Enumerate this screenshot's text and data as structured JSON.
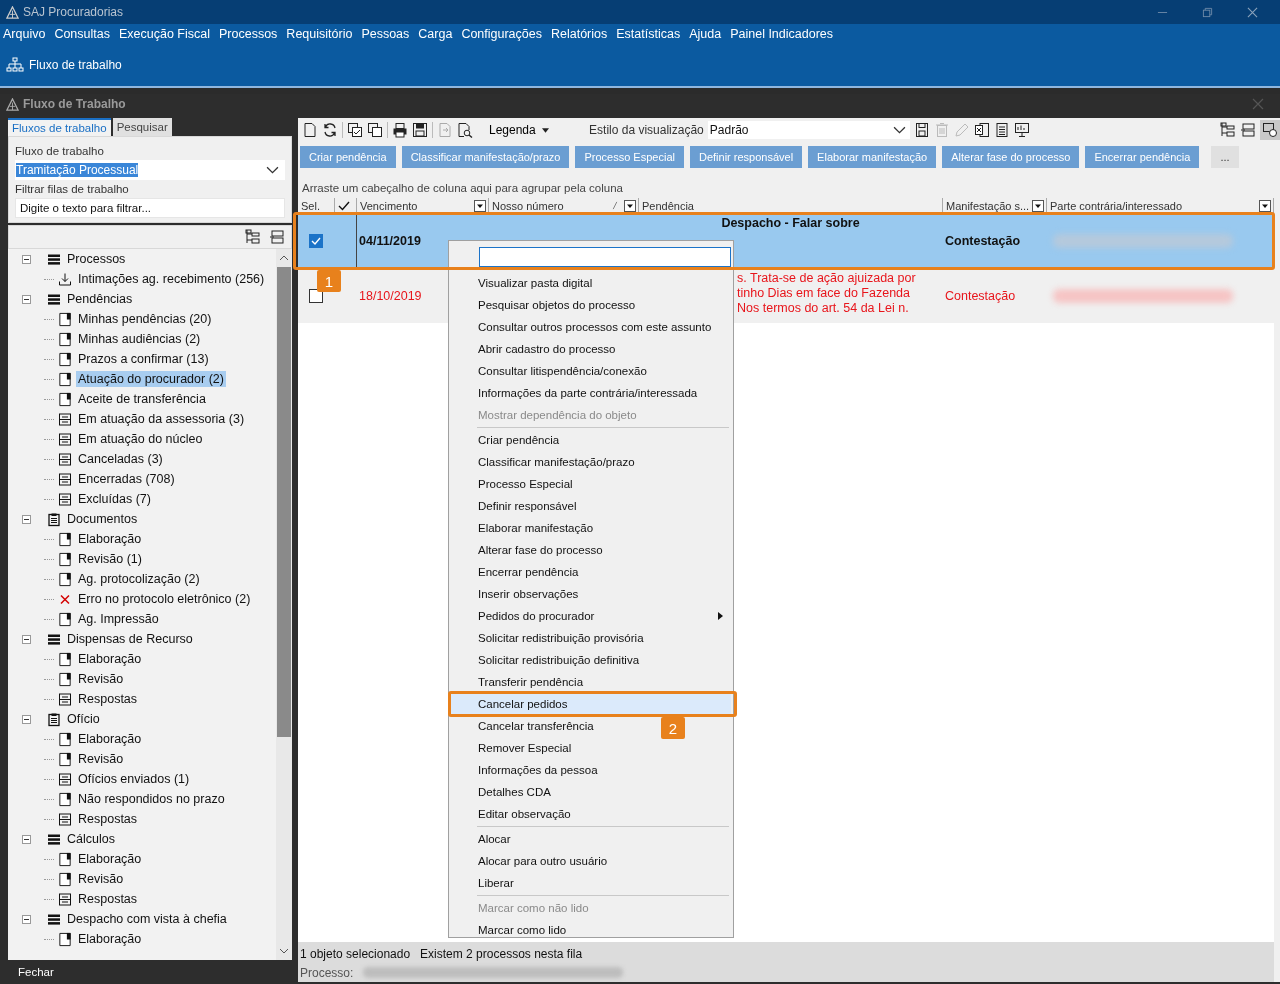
{
  "app_window": {
    "title": "SAJ Procuradorias"
  },
  "menu_bar": [
    "Arquivo",
    "Consultas",
    "Execução Fiscal",
    "Processos",
    "Requisitório",
    "Pessoas",
    "Carga",
    "Configurações",
    "Relatórios",
    "Estatísticas",
    "Ajuda",
    "Painel Indicadores"
  ],
  "ribbon": {
    "label": "Fluxo de trabalho"
  },
  "inner_window": {
    "title": "Fluxo de Trabalho"
  },
  "left_tabs": [
    {
      "label": "Fluxos de trabalho",
      "selected": true
    },
    {
      "label": "Pesquisar",
      "selected": false
    }
  ],
  "workflow": {
    "label": "Fluxo de trabalho",
    "value": "Tramitação Processual"
  },
  "filter": {
    "label": "Filtrar filas de trabalho",
    "placeholder": "Digite o texto para filtrar..."
  },
  "tree": [
    {
      "label": "Processos",
      "kind": "list",
      "expanded": true,
      "children": [
        {
          "label": "Intimações ag. recebimento (256)",
          "kind": "download",
          "selected": false
        }
      ]
    },
    {
      "label": "Pendências",
      "kind": "list",
      "expanded": true,
      "children": [
        {
          "label": "Minhas pendências (20)",
          "kind": "page",
          "selected": false
        },
        {
          "label": "Minhas audiências (2)",
          "kind": "page",
          "selected": false
        },
        {
          "label": "Prazos a confirmar (13)",
          "kind": "page",
          "selected": false
        },
        {
          "label": "Atuação do procurador (2)",
          "kind": "page",
          "selected": true
        },
        {
          "label": "Aceite de transferência",
          "kind": "page",
          "selected": false
        },
        {
          "label": "Em atuação da assessoria (3)",
          "kind": "table",
          "selected": false
        },
        {
          "label": "Em atuação do núcleo",
          "kind": "table",
          "selected": false
        },
        {
          "label": "Canceladas (3)",
          "kind": "table",
          "selected": false
        },
        {
          "label": "Encerradas (708)",
          "kind": "table",
          "selected": false
        },
        {
          "label": "Excluídas (7)",
          "kind": "table",
          "selected": false
        }
      ]
    },
    {
      "label": "Documentos",
      "kind": "clipboard",
      "expanded": true,
      "children": [
        {
          "label": "Elaboração",
          "kind": "page",
          "selected": false
        },
        {
          "label": "Revisão (1)",
          "kind": "page",
          "selected": false
        },
        {
          "label": "Ag. protocolização (2)",
          "kind": "page",
          "selected": false
        },
        {
          "label": "Erro no protocolo eletrônico (2)",
          "kind": "error",
          "selected": false
        },
        {
          "label": "Ag. Impressão",
          "kind": "page",
          "selected": false
        }
      ]
    },
    {
      "label": "Dispensas de Recurso",
      "kind": "list",
      "expanded": true,
      "children": [
        {
          "label": "Elaboração",
          "kind": "page",
          "selected": false
        },
        {
          "label": "Revisão",
          "kind": "page",
          "selected": false
        },
        {
          "label": "Respostas",
          "kind": "table",
          "selected": false
        }
      ]
    },
    {
      "label": "Ofício",
      "kind": "clipboard",
      "expanded": true,
      "children": [
        {
          "label": "Elaboração",
          "kind": "page",
          "selected": false
        },
        {
          "label": "Revisão",
          "kind": "page",
          "selected": false
        },
        {
          "label": "Ofícios enviados (1)",
          "kind": "table",
          "selected": false
        },
        {
          "label": "Não respondidos no prazo",
          "kind": "page",
          "selected": false
        },
        {
          "label": "Respostas",
          "kind": "table",
          "selected": false
        }
      ]
    },
    {
      "label": "Cálculos",
      "kind": "list",
      "expanded": true,
      "children": [
        {
          "label": "Elaboração",
          "kind": "page",
          "selected": false
        },
        {
          "label": "Revisão",
          "kind": "page",
          "selected": false
        },
        {
          "label": "Respostas",
          "kind": "table",
          "selected": false
        }
      ]
    },
    {
      "label": "Despacho com vista à chefia",
      "kind": "list",
      "expanded": true,
      "children": [
        {
          "label": "Elaboração",
          "kind": "page",
          "selected": false
        }
      ]
    }
  ],
  "close_button": "Fechar",
  "toolbar": {
    "legend": "Legenda",
    "style_label": "Estilo da visualização",
    "style_value": "Padrão"
  },
  "actions": [
    "Criar pendência",
    "Classificar manifestação/prazo",
    "Processo Especial",
    "Definir responsável",
    "Elaborar manifestação",
    "Alterar fase do processo",
    "Encerrar pendência",
    "..."
  ],
  "group_hint": "Arraste um cabeçalho de coluna aqui para agrupar pela coluna",
  "table": {
    "columns": [
      {
        "label": "Sel.",
        "kind": "text",
        "filter": false
      },
      {
        "kind": "check",
        "filter": false
      },
      {
        "label": "Vencimento",
        "kind": "text",
        "filter": true
      },
      {
        "label": "Nosso número",
        "kind": "sort",
        "filter": true
      },
      {
        "label": "Pendência",
        "kind": "text",
        "filter": false
      },
      {
        "label": "Manifestação s...",
        "kind": "text",
        "filter": true
      },
      {
        "label": "Parte contrária/interessado",
        "kind": "text",
        "filter": true
      }
    ],
    "rows": [
      {
        "selected": true,
        "overdue": false,
        "due": "04/11/2019",
        "pendencia": [
          "Despacho - Falar sobre"
        ],
        "manifestacao": "Contestação"
      },
      {
        "selected": false,
        "overdue": true,
        "due": "18/10/2019",
        "pendencia": [
          "s. Trata-se de ação ajuizada por",
          "tinho Dias em face do Fazenda",
          "Nos termos do art. 54 da Lei n."
        ],
        "manifestacao": "Contestação"
      }
    ]
  },
  "context_menu": [
    {
      "kind": "item",
      "label": "Visualizar pasta digital",
      "disabled": false,
      "selected": false,
      "submenu": false
    },
    {
      "kind": "item",
      "label": "Pesquisar objetos do processo",
      "disabled": false,
      "selected": false,
      "submenu": false
    },
    {
      "kind": "item",
      "label": "Consultar outros processos com este assunto",
      "disabled": false,
      "selected": false,
      "submenu": false
    },
    {
      "kind": "item",
      "label": "Abrir cadastro do processo",
      "disabled": false,
      "selected": false,
      "submenu": false
    },
    {
      "kind": "item",
      "label": "Consultar litispendência/conexão",
      "disabled": false,
      "selected": false,
      "submenu": false
    },
    {
      "kind": "item",
      "label": "Informações da parte contrária/interessada",
      "disabled": false,
      "selected": false,
      "submenu": false
    },
    {
      "kind": "item",
      "label": "Mostrar dependência do objeto",
      "disabled": true,
      "selected": false,
      "submenu": false
    },
    {
      "kind": "separator"
    },
    {
      "kind": "item",
      "label": "Criar pendência",
      "disabled": false,
      "selected": false,
      "submenu": false
    },
    {
      "kind": "item",
      "label": "Classificar manifestação/prazo",
      "disabled": false,
      "selected": false,
      "submenu": false
    },
    {
      "kind": "item",
      "label": "Processo Especial",
      "disabled": false,
      "selected": false,
      "submenu": false
    },
    {
      "kind": "item",
      "label": "Definir responsável",
      "disabled": false,
      "selected": false,
      "submenu": false
    },
    {
      "kind": "item",
      "label": "Elaborar manifestação",
      "disabled": false,
      "selected": false,
      "submenu": false
    },
    {
      "kind": "item",
      "label": "Alterar fase do processo",
      "disabled": false,
      "selected": false,
      "submenu": false
    },
    {
      "kind": "item",
      "label": "Encerrar pendência",
      "disabled": false,
      "selected": false,
      "submenu": false
    },
    {
      "kind": "item",
      "label": "Inserir observações",
      "disabled": false,
      "selected": false,
      "submenu": false
    },
    {
      "kind": "item",
      "label": "Pedidos do procurador",
      "disabled": false,
      "selected": false,
      "submenu": true
    },
    {
      "kind": "item",
      "label": "Solicitar redistribuição provisória",
      "disabled": false,
      "selected": false,
      "submenu": false
    },
    {
      "kind": "item",
      "label": "Solicitar redistribuição definitiva",
      "disabled": false,
      "selected": false,
      "submenu": false
    },
    {
      "kind": "item",
      "label": "Transferir pendência",
      "disabled": false,
      "selected": false,
      "submenu": false
    },
    {
      "kind": "item",
      "label": "Cancelar pedidos",
      "disabled": false,
      "selected": true,
      "submenu": false
    },
    {
      "kind": "item",
      "label": "Cancelar transferência",
      "disabled": false,
      "selected": false,
      "submenu": false
    },
    {
      "kind": "item",
      "label": "Remover Especial",
      "disabled": false,
      "selected": false,
      "submenu": false
    },
    {
      "kind": "item",
      "label": "Informações da pessoa",
      "disabled": false,
      "selected": false,
      "submenu": false
    },
    {
      "kind": "item",
      "label": "Detalhes CDA",
      "disabled": false,
      "selected": false,
      "submenu": false
    },
    {
      "kind": "item",
      "label": "Editar observação",
      "disabled": false,
      "selected": false,
      "submenu": false
    },
    {
      "kind": "separator"
    },
    {
      "kind": "item",
      "label": "Alocar",
      "disabled": false,
      "selected": false,
      "submenu": false
    },
    {
      "kind": "item",
      "label": "Alocar para outro usuário",
      "disabled": false,
      "selected": false,
      "submenu": false
    },
    {
      "kind": "item",
      "label": "Liberar",
      "disabled": false,
      "selected": false,
      "submenu": false
    },
    {
      "kind": "separator"
    },
    {
      "kind": "item",
      "label": "Marcar como não lido",
      "disabled": true,
      "selected": false,
      "submenu": false
    },
    {
      "kind": "item",
      "label": "Marcar como lido",
      "disabled": false,
      "selected": false,
      "submenu": false
    }
  ],
  "annotations": [
    {
      "label": "1"
    },
    {
      "label": "2"
    }
  ],
  "status_bar": {
    "selection": "1 objeto selecionado",
    "count": "Existem 2 processos nesta fila",
    "process_label": "Processo:"
  }
}
